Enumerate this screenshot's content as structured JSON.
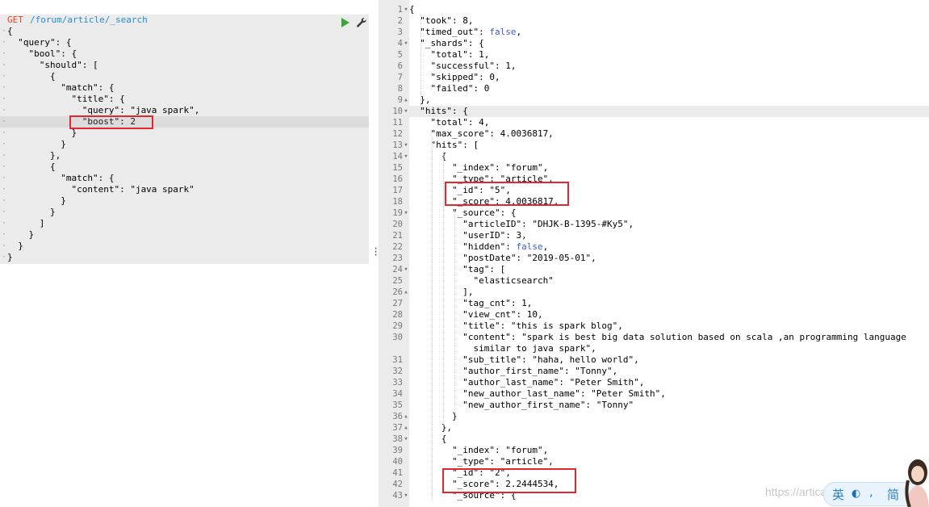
{
  "request": {
    "method": "GET",
    "path": "/forum/article/_search",
    "lines": [
      "{",
      "  \"query\": {",
      "    \"bool\": {",
      "      \"should\": [",
      "        {",
      "          \"match\": {",
      "            \"title\": {",
      "              \"query\": \"java spark\",",
      "              \"boost\": 2",
      "            }",
      "          }",
      "        },",
      "        {",
      "          \"match\": {",
      "            \"content\": \"java spark\"",
      "          }",
      "        }",
      "      ]",
      "    }",
      "  }",
      "}"
    ]
  },
  "toolbar": {
    "run_icon": "play-icon",
    "settings_icon": "wrench-icon"
  },
  "response": {
    "lines": [
      {
        "n": "1",
        "f": "▾",
        "t": "{"
      },
      {
        "n": "2",
        "f": "",
        "t": "  \"took\": 8,"
      },
      {
        "n": "3",
        "f": "",
        "t": "  \"timed_out\": false,"
      },
      {
        "n": "4",
        "f": "▾",
        "t": "  \"_shards\": {"
      },
      {
        "n": "5",
        "f": "",
        "t": "    \"total\": 1,"
      },
      {
        "n": "6",
        "f": "",
        "t": "    \"successful\": 1,"
      },
      {
        "n": "7",
        "f": "",
        "t": "    \"skipped\": 0,"
      },
      {
        "n": "8",
        "f": "",
        "t": "    \"failed\": 0"
      },
      {
        "n": "9",
        "f": "▴",
        "t": "  },"
      },
      {
        "n": "10",
        "f": "▾",
        "t": "  \"hits\": {"
      },
      {
        "n": "11",
        "f": "",
        "t": "    \"total\": 4,"
      },
      {
        "n": "12",
        "f": "",
        "t": "    \"max_score\": 4.0036817,"
      },
      {
        "n": "13",
        "f": "▾",
        "t": "    \"hits\": ["
      },
      {
        "n": "14",
        "f": "▾",
        "t": "      {"
      },
      {
        "n": "15",
        "f": "",
        "t": "        \"_index\": \"forum\","
      },
      {
        "n": "16",
        "f": "",
        "t": "        \"_type\": \"article\","
      },
      {
        "n": "17",
        "f": "",
        "t": "        \"_id\": \"5\","
      },
      {
        "n": "18",
        "f": "",
        "t": "        \"_score\": 4.0036817,"
      },
      {
        "n": "19",
        "f": "▾",
        "t": "        \"_source\": {"
      },
      {
        "n": "20",
        "f": "",
        "t": "          \"articleID\": \"DHJK-B-1395-#Ky5\","
      },
      {
        "n": "21",
        "f": "",
        "t": "          \"userID\": 3,"
      },
      {
        "n": "22",
        "f": "",
        "t": "          \"hidden\": false,"
      },
      {
        "n": "23",
        "f": "",
        "t": "          \"postDate\": \"2019-05-01\","
      },
      {
        "n": "24",
        "f": "▾",
        "t": "          \"tag\": ["
      },
      {
        "n": "25",
        "f": "",
        "t": "            \"elasticsearch\""
      },
      {
        "n": "26",
        "f": "▴",
        "t": "          ],"
      },
      {
        "n": "27",
        "f": "",
        "t": "          \"tag_cnt\": 1,"
      },
      {
        "n": "28",
        "f": "",
        "t": "          \"view_cnt\": 10,"
      },
      {
        "n": "29",
        "f": "",
        "t": "          \"title\": \"this is spark blog\","
      },
      {
        "n": "30",
        "f": "",
        "t": "          \"content\": \"spark is best big data solution based on scala ,an programming language"
      },
      {
        "n": "",
        "f": "",
        "t": "            similar to java spark\","
      },
      {
        "n": "31",
        "f": "",
        "t": "          \"sub_title\": \"haha, hello world\","
      },
      {
        "n": "32",
        "f": "",
        "t": "          \"author_first_name\": \"Tonny\","
      },
      {
        "n": "33",
        "f": "",
        "t": "          \"author_last_name\": \"Peter Smith\","
      },
      {
        "n": "34",
        "f": "",
        "t": "          \"new_author_last_name\": \"Peter Smith\","
      },
      {
        "n": "35",
        "f": "",
        "t": "          \"new_author_first_name\": \"Tonny\""
      },
      {
        "n": "36",
        "f": "▴",
        "t": "        }"
      },
      {
        "n": "37",
        "f": "▴",
        "t": "      },"
      },
      {
        "n": "38",
        "f": "▾",
        "t": "      {"
      },
      {
        "n": "39",
        "f": "",
        "t": "        \"_index\": \"forum\","
      },
      {
        "n": "40",
        "f": "",
        "t": "        \"_type\": \"article\","
      },
      {
        "n": "41",
        "f": "",
        "t": "        \"_id\": \"2\","
      },
      {
        "n": "42",
        "f": "",
        "t": "        \"_score\": 2.2444534,"
      },
      {
        "n": "43",
        "f": "▾",
        "t": "        \"_source\": {"
      }
    ]
  },
  "ime": {
    "lang": "英",
    "mode": "简",
    "moon": "◐",
    "dot": ","
  },
  "watermark": "https://artica...blog.csdn.net"
}
